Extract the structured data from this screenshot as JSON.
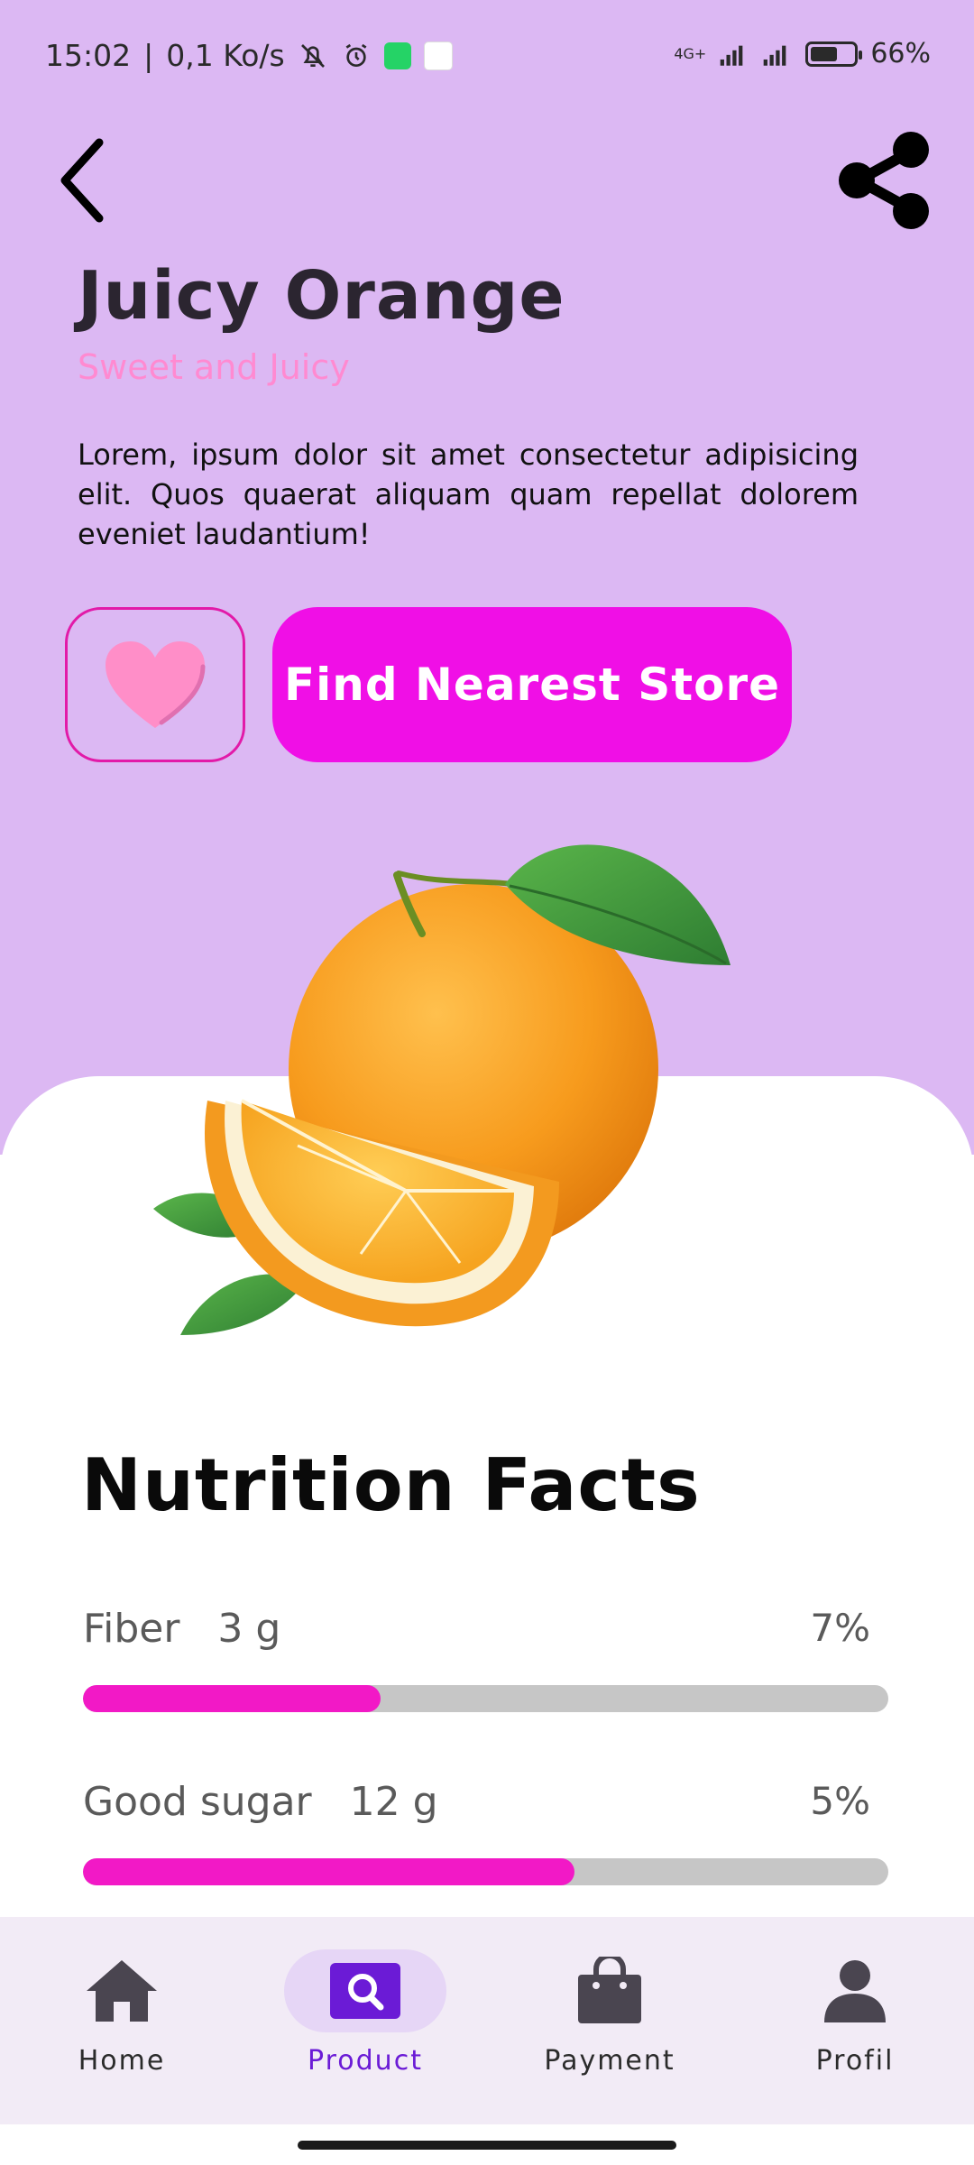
{
  "status_bar": {
    "time": "15:02",
    "speed": "0,1 Ko/s",
    "network_label": "4G+",
    "battery_text": "66%",
    "battery_level": 0.66
  },
  "product": {
    "title": "Juicy Orange",
    "subtitle": "Sweet and Juicy",
    "description": "Lorem, ipsum dolor sit amet consectetur adipisicing elit. Quos quaerat aliquam quam repellat dolorem eveniet laudantium!",
    "find_store_label": "Find Nearest Store",
    "favorite_color": "#ff8ec8",
    "accent_color": "#f00fe6"
  },
  "nutrition": {
    "title": "Nutrition Facts",
    "items": [
      {
        "name": "Fiber",
        "amount": "3 g",
        "percent_text": "7%",
        "bar_fraction": 0.37
      },
      {
        "name": "Good sugar",
        "amount": "12 g",
        "percent_text": "5%",
        "bar_fraction": 0.61
      }
    ]
  },
  "nav": {
    "items": [
      {
        "label": "Home",
        "icon": "home-icon",
        "active": false
      },
      {
        "label": "Product",
        "icon": "search-icon",
        "active": true
      },
      {
        "label": "Payment",
        "icon": "shopping-bag-icon",
        "active": false
      },
      {
        "label": "Profil",
        "icon": "person-icon",
        "active": false
      }
    ],
    "active_color": "#6b1bd6"
  }
}
